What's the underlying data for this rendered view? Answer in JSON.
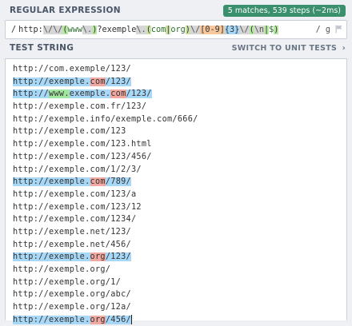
{
  "regex": {
    "section_title": "REGULAR EXPRESSION",
    "match_info": "5 matches, 539 steps (~2ms)",
    "delimiter": "/",
    "tokens": [
      {
        "text": "http:",
        "style": "plain"
      },
      {
        "text": "\\/",
        "style": "gray"
      },
      {
        "text": "\\/",
        "style": "gray"
      },
      {
        "text": "(",
        "style": "green"
      },
      {
        "text": "www",
        "style": "grp"
      },
      {
        "text": "\\.",
        "style": "gray"
      },
      {
        "text": ")",
        "style": "green"
      },
      {
        "text": "?exemple",
        "style": "plain"
      },
      {
        "text": "\\.",
        "style": "gray"
      },
      {
        "text": "(",
        "style": "olive"
      },
      {
        "text": "com",
        "style": "grp"
      },
      {
        "text": "|",
        "style": "olive"
      },
      {
        "text": "org",
        "style": "grp"
      },
      {
        "text": ")",
        "style": "olive"
      },
      {
        "text": "\\/",
        "style": "gray"
      },
      {
        "text": "[0-9]",
        "style": "orange"
      },
      {
        "text": "{3}",
        "style": "blue"
      },
      {
        "text": "\\/",
        "style": "gray"
      },
      {
        "text": "(",
        "style": "green"
      },
      {
        "text": "\\n",
        "style": "gray"
      },
      {
        "text": "|",
        "style": "green"
      },
      {
        "text": "$",
        "style": "grp"
      },
      {
        "text": ")",
        "style": "green"
      }
    ],
    "flags": "/ g"
  },
  "test": {
    "section_title": "TEST STRING",
    "switch_label": "SWITCH TO UNIT TESTS",
    "switch_chevron": "›",
    "lines": [
      [
        {
          "t": "http://com.exemple/123/"
        }
      ],
      [
        {
          "t": "http://exemple.",
          "c": "url"
        },
        {
          "t": "com",
          "c": "dom"
        },
        {
          "t": "/123/",
          "c": "url"
        }
      ],
      [
        {
          "t": "http://",
          "c": "url"
        },
        {
          "t": "www.",
          "c": "www"
        },
        {
          "t": "exemple.",
          "c": "url"
        },
        {
          "t": "com",
          "c": "dom"
        },
        {
          "t": "/123/",
          "c": "url"
        }
      ],
      [
        {
          "t": "http://exemple.com.fr/123/"
        }
      ],
      [
        {
          "t": "http://exemple.info/exemple.com/666/"
        }
      ],
      [
        {
          "t": "http://exemple.com/123"
        }
      ],
      [
        {
          "t": "http://exemple.com/123.html"
        }
      ],
      [
        {
          "t": "http://exemple.com/123/456/"
        }
      ],
      [
        {
          "t": "http://exemple.com/1/2/3/"
        }
      ],
      [
        {
          "t": "http://exemple.",
          "c": "url"
        },
        {
          "t": "com",
          "c": "dom"
        },
        {
          "t": "/789/",
          "c": "url"
        }
      ],
      [
        {
          "t": "http://exemple.com/123/a"
        }
      ],
      [
        {
          "t": "http://exemple.com/123/12"
        }
      ],
      [
        {
          "t": "http://exemple.com/1234/"
        }
      ],
      [
        {
          "t": "http://exemple.net/123/"
        }
      ],
      [
        {
          "t": "http://exemple.net/456/"
        }
      ],
      [
        {
          "t": "http://exemple.",
          "c": "url"
        },
        {
          "t": "org",
          "c": "dom"
        },
        {
          "t": "/123/",
          "c": "url"
        }
      ],
      [
        {
          "t": "http://exemple.org/"
        }
      ],
      [
        {
          "t": "http://exemple.org/1/"
        }
      ],
      [
        {
          "t": "http://exemple.org/abc/"
        }
      ],
      [
        {
          "t": "http://exemple.org/12a/"
        }
      ],
      [
        {
          "t": "http://exemple.",
          "c": "url"
        },
        {
          "t": "org",
          "c": "dom"
        },
        {
          "t": "/456/",
          "c": "url"
        },
        {
          "t": "caret",
          "c": "caret"
        }
      ]
    ]
  },
  "colors": {
    "match": "#a8d8f7",
    "group_domain": "#f0a8a0",
    "group_www": "#a0e5a0",
    "badge": "#3a8f6c"
  }
}
